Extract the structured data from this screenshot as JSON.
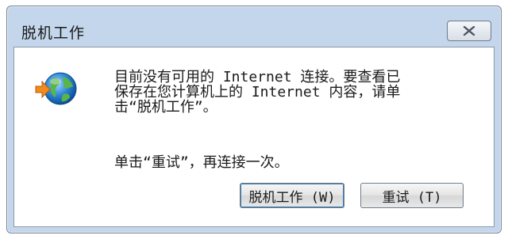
{
  "window": {
    "title": "脱机工作"
  },
  "dialog": {
    "message": "目前没有可用的 Internet 连接。要查看已\n保存在您计算机上的 Internet 内容，请单\n击“脱机工作”。",
    "hint": "单击“重试”，再连接一次。"
  },
  "buttons": {
    "offline_label": "脱机工作 (W)",
    "retry_label": "重试 (T)"
  },
  "icons": {
    "close": "close-icon",
    "status": "globe-arrow-icon"
  }
}
